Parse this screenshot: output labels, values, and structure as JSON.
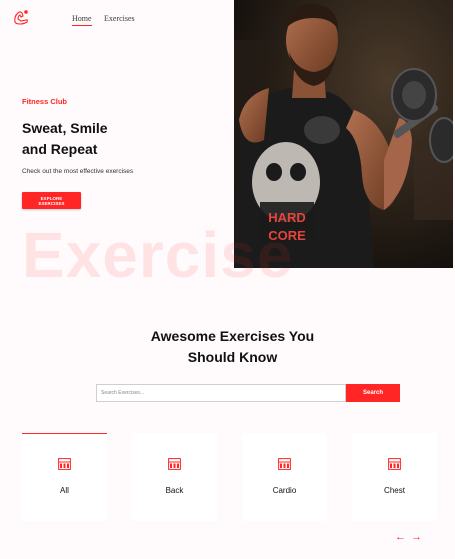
{
  "colors": {
    "accent": "#ff2625",
    "background": "#fffafb",
    "card": "#ffffff"
  },
  "nav": {
    "logo_icon": "gym-logo-icon",
    "links": [
      {
        "label": "Home",
        "active": true
      },
      {
        "label": "Exercises",
        "active": false
      }
    ]
  },
  "hero": {
    "subtitle": "Fitness Club",
    "title_line1": "Sweat, Smile",
    "title_line2": "and Repeat",
    "description": "Check out the most effective exercises",
    "button_label": "EXPLORE EXERCISES",
    "background_word": "Exercise",
    "image": "man-lifting-dumbbell-photo",
    "shirt_text_line1": "HARD",
    "shirt_text_line2": "CORE"
  },
  "search": {
    "title_line1": "Awesome Exercises You",
    "title_line2": "Should Know",
    "placeholder": "Search Exercises...",
    "button_label": "Search"
  },
  "categories": {
    "icon": "gym-icon",
    "items": [
      {
        "label": "All",
        "active": true
      },
      {
        "label": "Back",
        "active": false
      },
      {
        "label": "Cardio",
        "active": false
      },
      {
        "label": "Chest",
        "active": false
      }
    ]
  },
  "pagination": {
    "prev_icon": "arrow-left-icon",
    "next_icon": "arrow-right-icon",
    "prev_glyph": "←",
    "next_glyph": "→"
  }
}
